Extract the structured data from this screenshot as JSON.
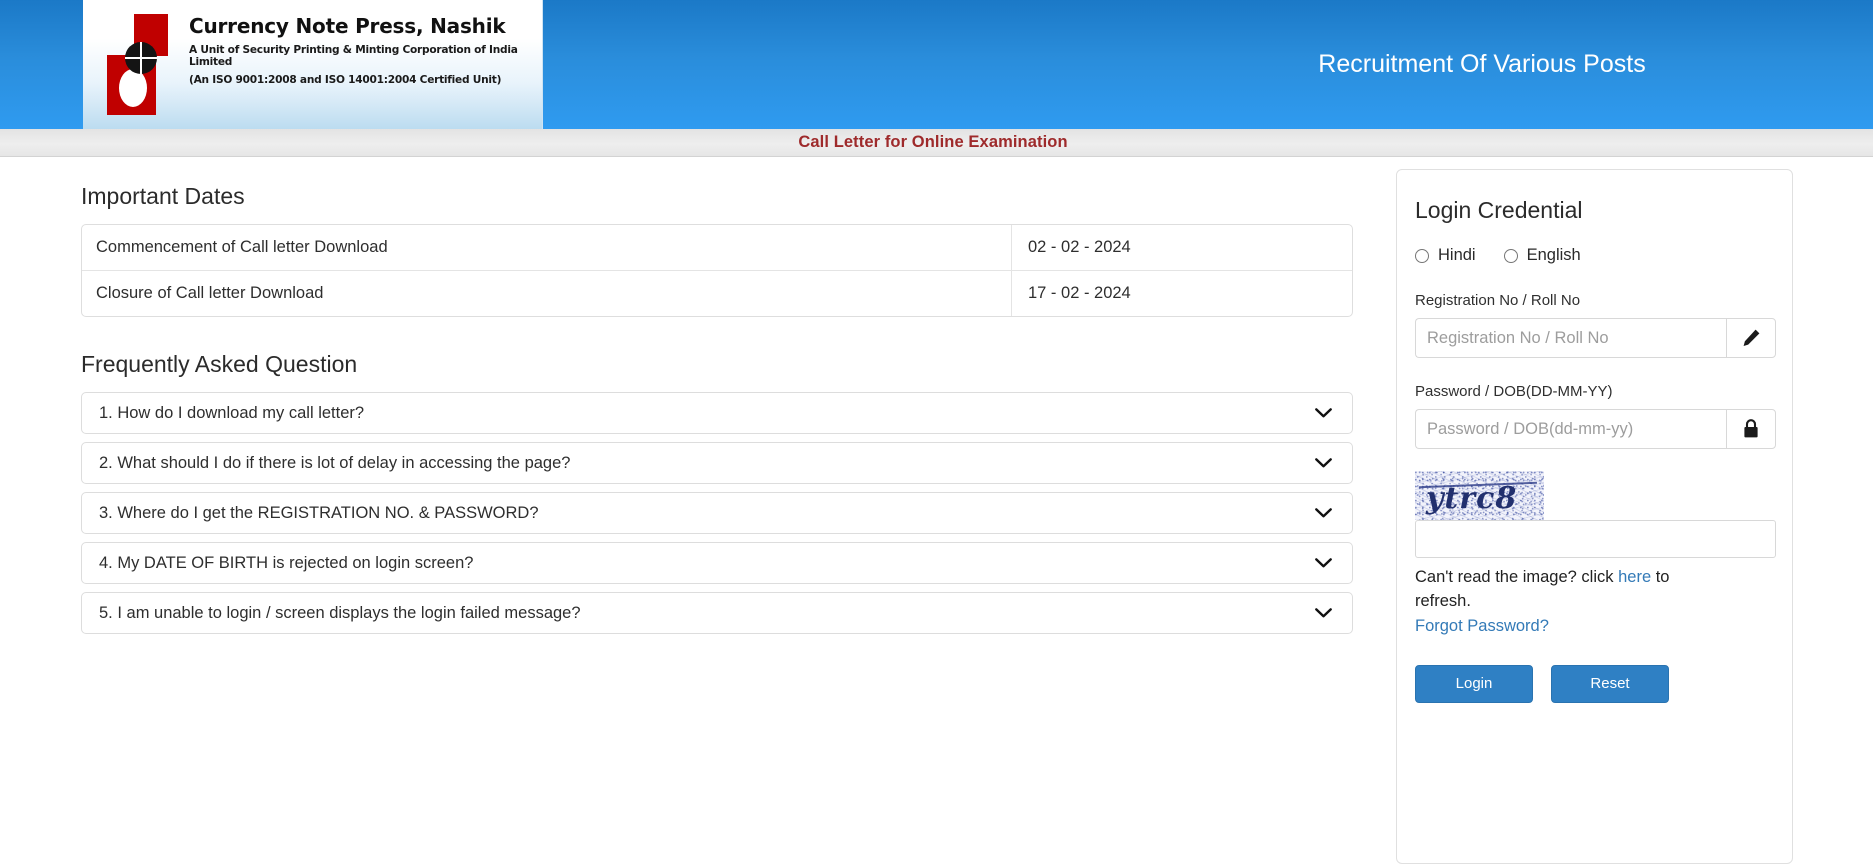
{
  "header": {
    "org_name": "Currency Note Press, Nashik",
    "org_sub1": "A Unit of Security Printing & Minting Corporation of India Limited",
    "org_sub2": "(An ISO 9001:2008 and ISO 14001:2004 Certified Unit)",
    "title": "Recruitment Of Various Posts",
    "banner": "Call Letter for Online Examination",
    "banner_color": "#9e2a2b",
    "brand_blue": "#2a8ddb"
  },
  "important_dates": {
    "heading": "Important Dates",
    "rows": [
      {
        "label": "Commencement of Call letter Download",
        "date": "02 - 02 - 2024"
      },
      {
        "label": "Closure of Call letter Download",
        "date": "17 - 02 - 2024"
      }
    ]
  },
  "faq": {
    "heading": "Frequently Asked Question",
    "items": [
      {
        "text": "1. How do I download my call letter?"
      },
      {
        "text": "2. What should I do if there is lot of delay in accessing the page?"
      },
      {
        "text": "3. Where do I get the REGISTRATION NO. & PASSWORD?"
      },
      {
        "text": "4. My DATE OF BIRTH is rejected on login screen?"
      },
      {
        "text": "5. I am unable to login / screen displays the login failed message?"
      }
    ]
  },
  "login": {
    "title": "Login Credential",
    "languages": [
      {
        "label": "Hindi",
        "selected": false
      },
      {
        "label": "English",
        "selected": false
      }
    ],
    "registration": {
      "label": "Registration No / Roll No",
      "placeholder": "Registration No / Roll No",
      "value": "",
      "icon": "pencil-icon"
    },
    "password": {
      "label": "Password / DOB(DD-MM-YY)",
      "placeholder": "Password / DOB(dd-mm-yy)",
      "value": "",
      "icon": "lock-icon"
    },
    "captcha": {
      "text": "ytrc8",
      "input_value": "",
      "input_placeholder": "",
      "help_prefix": "Can't read the image? click ",
      "help_link": "here",
      "help_suffix": " to refresh.",
      "color": "#22306e"
    },
    "forgot_password": "Forgot Password?",
    "buttons": [
      {
        "label": "Login"
      },
      {
        "label": "Reset"
      }
    ],
    "link_color": "#337ab7"
  }
}
